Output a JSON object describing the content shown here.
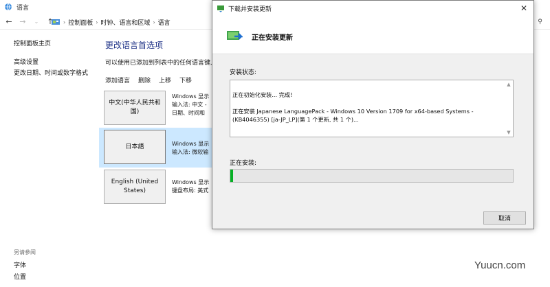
{
  "window": {
    "title": "语言"
  },
  "addressbar": {
    "breadcrumbs": [
      "控制面板",
      "时钟、语言和区域",
      "语言"
    ]
  },
  "sidebar": {
    "links": [
      "控制面板主页",
      "高级设置",
      "更改日期、时间或数字格式"
    ],
    "see_also_title": "另请参阅",
    "see_also_links": [
      "字体",
      "位置"
    ]
  },
  "main": {
    "title": "更改语言首选项",
    "description": "可以使用已添加到列表中的任何语言键入",
    "toolbar": [
      "添加语言",
      "删除",
      "上移",
      "下移"
    ],
    "languages": [
      {
        "name": "中文(中华人民共和国)",
        "info": [
          "Windows 显示",
          "输入法: 中文 -",
          "日期、时间和"
        ]
      },
      {
        "name": "日本語",
        "info": [
          "Windows 显示",
          "输入法: 微软输"
        ]
      },
      {
        "name": "English (United States)",
        "info": [
          "Windows 显示",
          "键盘布局: 美式"
        ]
      }
    ],
    "selected_index": 1
  },
  "dialog": {
    "title": "下载并安装更新",
    "header": "正在安装更新",
    "status_label": "安装状态:",
    "log_lines": [
      "正在初始化安装... 完成!",
      "正在安装 Japanese LanguagePack - Windows 10 Version 1709 for x64-based Systems - (KB4046355) [ja-JP_LP](第 1 个更新, 共 1 个)..."
    ],
    "installing_label": "正在安装:",
    "progress": 0.01,
    "cancel_label": "取消"
  },
  "watermark": "Yuucn.com",
  "colors": {
    "title_blue": "#1e3287",
    "progress_green": "#06b025",
    "selected_row": "#cce8ff"
  }
}
